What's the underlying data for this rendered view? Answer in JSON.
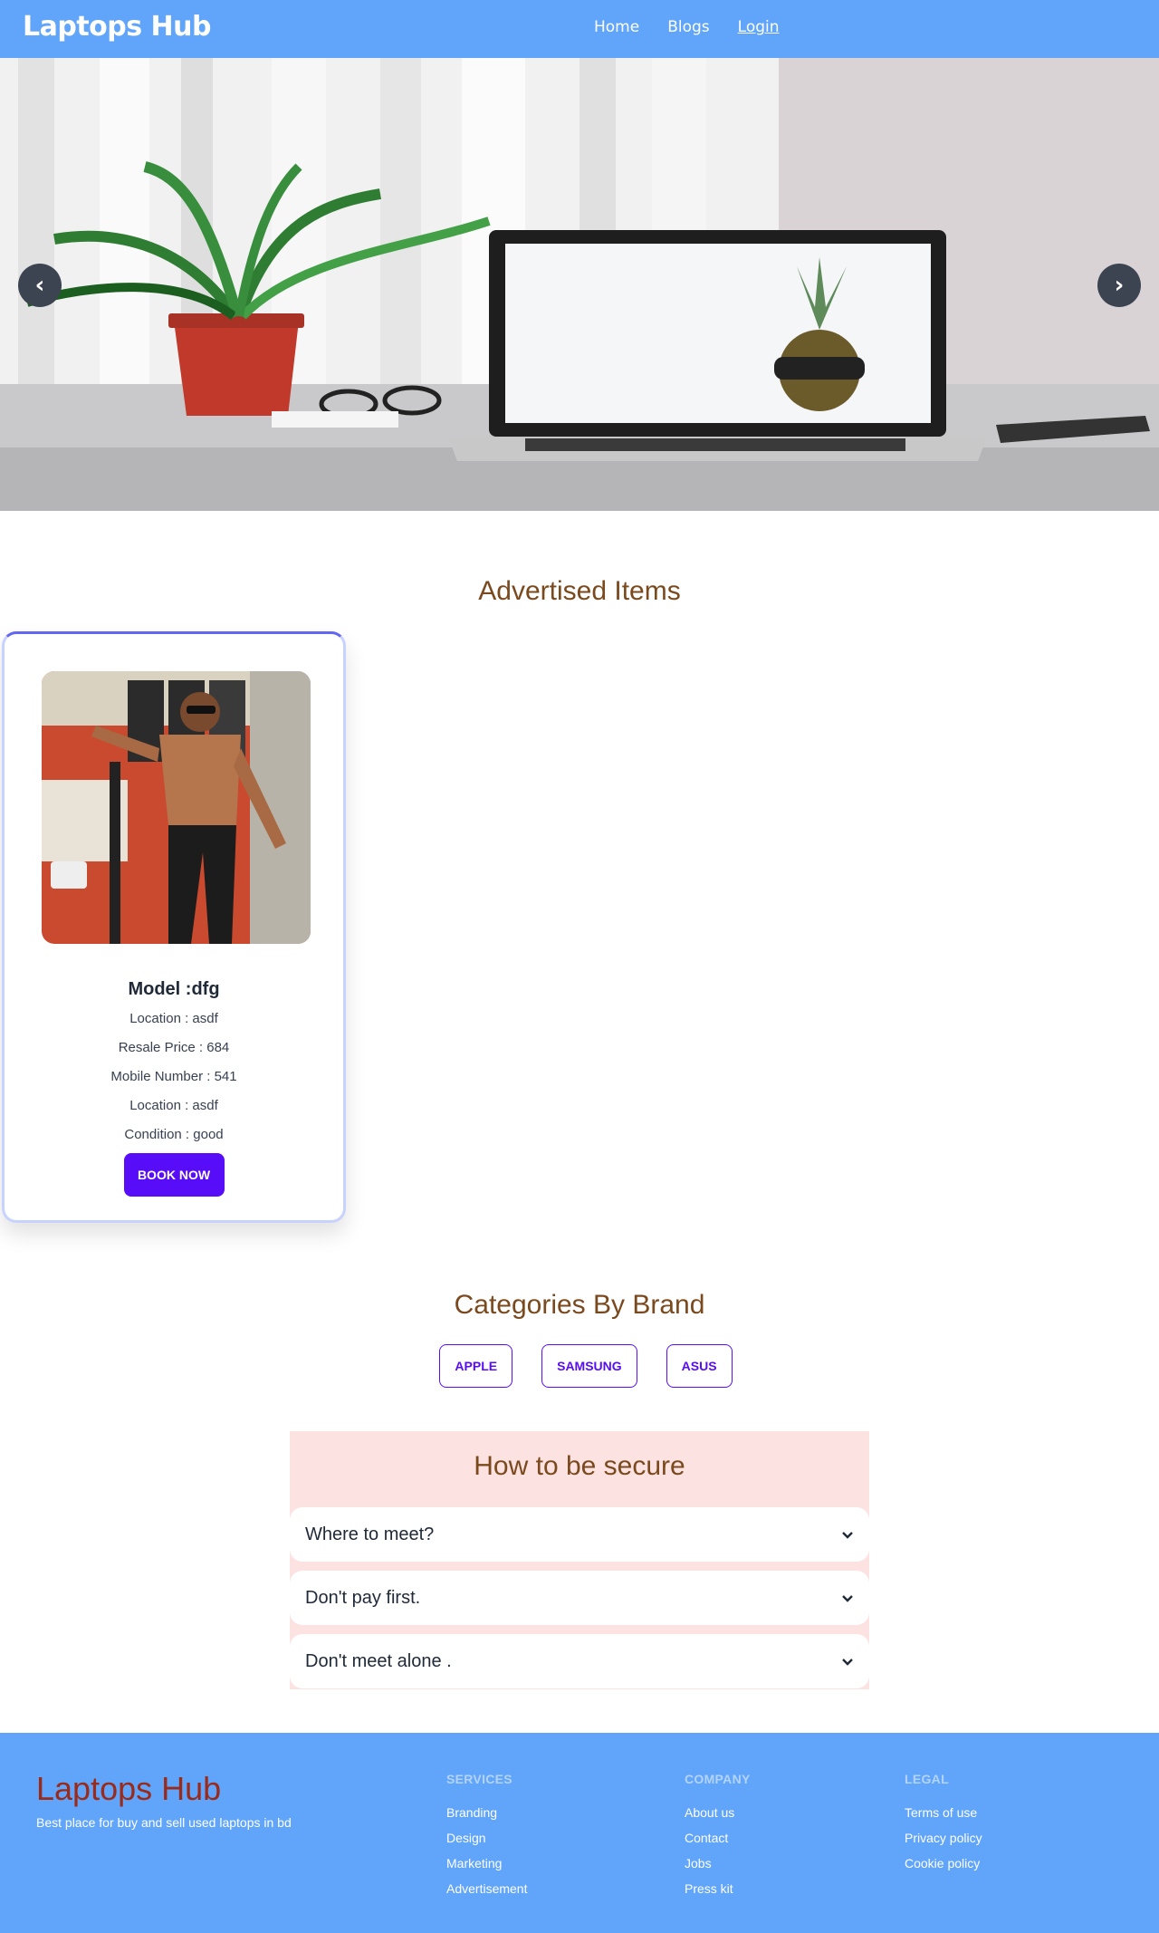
{
  "navbar": {
    "brand": "Laptops Hub",
    "links": {
      "home": "Home",
      "blogs": "Blogs",
      "login": "Login"
    }
  },
  "hero": {
    "prev_label": "‹",
    "next_label": "›"
  },
  "advertised": {
    "title": "Advertised Items",
    "card": {
      "model": "Model :dfg",
      "location": "Location : asdf",
      "resale_price": "Resale Price : 684",
      "mobile_number": "Mobile Number : 541",
      "location2": "Location : asdf",
      "condition": "Condition : good",
      "book_label": "BOOK NOW"
    }
  },
  "categories": {
    "title": "Categories By Brand",
    "brands": [
      "APPLE",
      "SAMSUNG",
      "ASUS"
    ]
  },
  "secure": {
    "title": "How to be secure",
    "faqs": [
      "Where to meet?",
      "Don't pay first.",
      "Don't meet alone ."
    ]
  },
  "footer": {
    "brand": "Laptops Hub",
    "tagline": "Best place for buy and sell used laptops in bd",
    "services": {
      "heading": "SERVICES",
      "items": [
        "Branding",
        "Design",
        "Marketing",
        "Advertisement"
      ]
    },
    "company": {
      "heading": "COMPANY",
      "items": [
        "About us",
        "Contact",
        "Jobs",
        "Press kit"
      ]
    },
    "legal": {
      "heading": "LEGAL",
      "items": [
        "Terms of use",
        "Privacy policy",
        "Cookie policy"
      ]
    }
  },
  "colors": {
    "navbar_bg": "#60a5fa",
    "primary": "#570df8",
    "heading_brown": "#7a4a1e",
    "secure_bg": "#fde2e2",
    "footer_brand": "#9a2a1a"
  }
}
